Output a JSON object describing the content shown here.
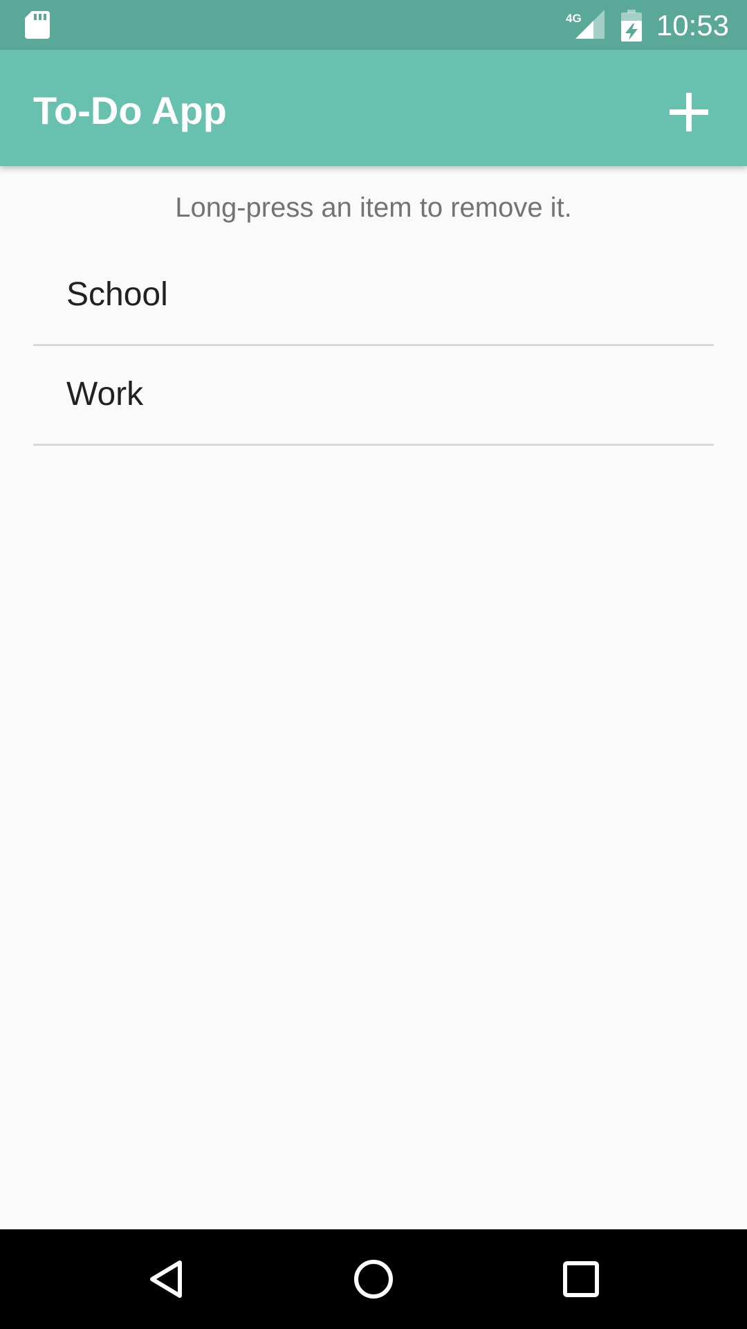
{
  "status_bar": {
    "time": "10:53",
    "network_label": "4G",
    "icons": [
      "sd-card-icon",
      "cell-signal-icon",
      "battery-charging-icon"
    ]
  },
  "app_bar": {
    "title": "To-Do App",
    "add_icon": "plus-icon"
  },
  "hint": "Long-press an item to remove it.",
  "todo_items": [
    {
      "label": "School"
    },
    {
      "label": "Work"
    }
  ],
  "nav_bar": {
    "icons": [
      "back-icon",
      "home-icon",
      "recents-icon"
    ]
  },
  "colors": {
    "status_bar": "#5aa898",
    "app_bar": "#67c1ae",
    "background": "#fafafa",
    "divider": "#d9d9d9",
    "hint_text": "#737373",
    "item_text": "#212121",
    "nav_bar": "#000000"
  }
}
